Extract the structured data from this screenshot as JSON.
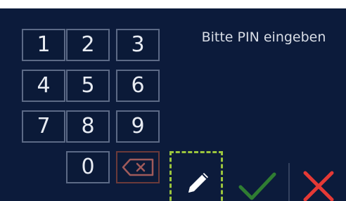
{
  "prompt": "Bitte PIN eingeben",
  "keypad": {
    "digits": [
      "1",
      "2",
      "3",
      "4",
      "5",
      "6",
      "7",
      "8",
      "9",
      "0"
    ]
  },
  "icons": {
    "backspace": "backspace-icon",
    "edit": "pencil-icon",
    "confirm": "checkmark-icon",
    "cancel": "close-icon"
  },
  "colors": {
    "background": "#0c1b3b",
    "key_border": "#5c6a86",
    "backspace_border": "#6b3a3a",
    "focus_outline": "#9bc53d",
    "confirm": "#2f7d32",
    "cancel": "#e53935"
  }
}
